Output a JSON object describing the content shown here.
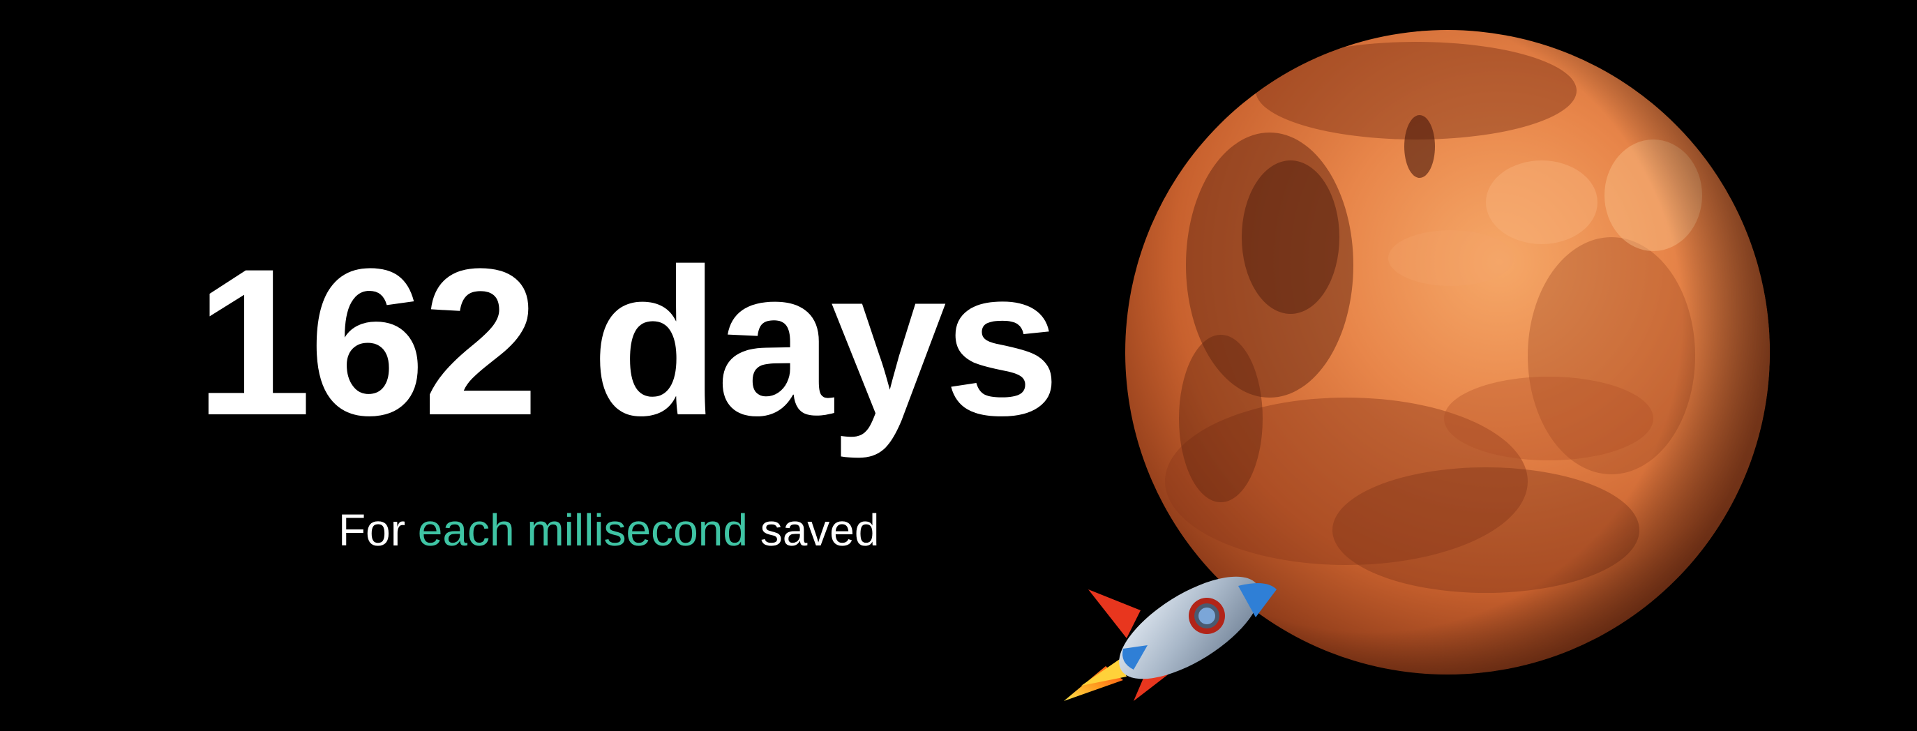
{
  "headline": "162 days",
  "subline": {
    "prefix": "For ",
    "highlight": "each millisecond",
    "suffix": " saved"
  },
  "colors": {
    "background": "#000000",
    "headline": "#ffffff",
    "subline": "#ffffff",
    "accent": "#3fc4a4"
  },
  "illustrations": {
    "planet": "mars-planet-illustration",
    "rocket": "rocket-icon"
  }
}
